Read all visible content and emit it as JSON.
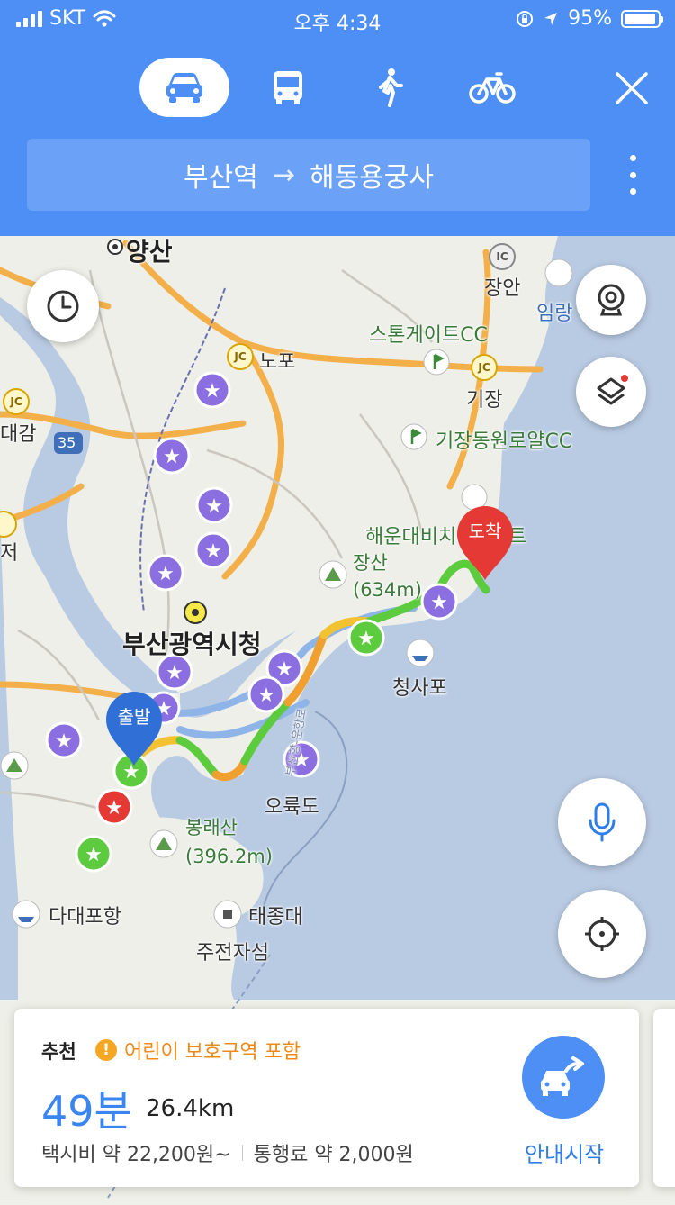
{
  "status_bar": {
    "carrier": "SKT",
    "time": "오후 4:34",
    "battery": "95%",
    "battery_level": 0.95
  },
  "modes": [
    {
      "name": "car",
      "icon": "car-icon",
      "active": true
    },
    {
      "name": "bus",
      "icon": "bus-icon",
      "active": false
    },
    {
      "name": "walk",
      "icon": "walk-icon",
      "active": false
    },
    {
      "name": "bike",
      "icon": "bike-icon",
      "active": false
    }
  ],
  "route": {
    "origin": "부산역",
    "arrow": "→",
    "destination": "해동용궁사"
  },
  "map": {
    "labels": {
      "yangsan": "양산",
      "nopo": "노포",
      "jangan": "장안",
      "imnang": "임랑",
      "stonegate": "스톤게이트CC",
      "gijang": "기장",
      "gijang_royal": "기장동원로얄CC",
      "haeundae_resort": "해운대비치&리조트",
      "jangsan": "장산",
      "jangsan_height": "(634m)",
      "city_hall": "부산광역시청",
      "cheongsapo": "청사포",
      "oryukdo": "오륙도",
      "bongnaesan": "봉래산",
      "bongnaesan_height": "(396.2m)",
      "dadaepo": "다대포항",
      "taejongdae": "태종대",
      "jujeon": "주전자섬",
      "daegam": "대감",
      "jeo": "저",
      "route_35": "35",
      "jc": "JC",
      "sea_route": "부산항-운항로"
    },
    "start_marker": "출발",
    "end_marker": "도착"
  },
  "card": {
    "recommend": "추천",
    "warning": "어린이 보호구역 포함",
    "duration": "49분",
    "distance": "26.4km",
    "taxi_fare": "택시비 약 22,200원~",
    "toll": "통행료 약 2,000원",
    "start_label": "안내시작"
  },
  "colors": {
    "header_blue": "#4d8ff5",
    "route_green": "#5ccb3d",
    "route_yellow": "#f2c230",
    "route_orange": "#f0a030",
    "sea": "#b9cbe3",
    "warning_orange": "#ee8a1a",
    "start_marker": "#2f6fd6",
    "end_marker": "#e53935"
  }
}
